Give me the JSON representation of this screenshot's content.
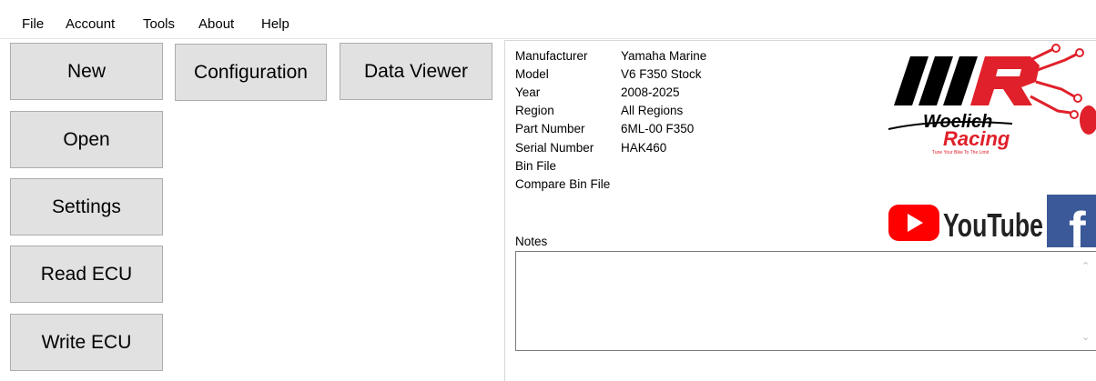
{
  "menu": {
    "items": [
      "File",
      "Account",
      "Tools",
      "About",
      "Help"
    ]
  },
  "buttons": {
    "new": "New",
    "configuration": "Configuration",
    "data_viewer": "Data Viewer",
    "open": "Open",
    "settings": "Settings",
    "read_ecu": "Read ECU",
    "write_ecu": "Write ECU"
  },
  "info": {
    "rows": [
      {
        "label": "Manufacturer",
        "value": "Yamaha Marine"
      },
      {
        "label": "Model",
        "value": "V6 F350 Stock"
      },
      {
        "label": "Year",
        "value": "2008-2025"
      },
      {
        "label": "Region",
        "value": "All Regions"
      },
      {
        "label": "Part Number",
        "value": "6ML-00 F350"
      },
      {
        "label": "Serial Number",
        "value": "HAK460"
      },
      {
        "label": "Bin File",
        "value": ""
      },
      {
        "label": "Compare Bin File",
        "value": ""
      }
    ]
  },
  "notes": {
    "label": "Notes",
    "value": ""
  },
  "logos": {
    "brand_line1": "Woelich",
    "brand_line2": "Racing",
    "brand_tagline": "Tune Your Bike To The Limit",
    "youtube": "YouTube",
    "facebook": "f"
  },
  "colors": {
    "button_bg": "#e1e1e1",
    "brand_red": "#e0202a",
    "youtube_red": "#ff0000",
    "facebook_blue": "#3b5998"
  }
}
